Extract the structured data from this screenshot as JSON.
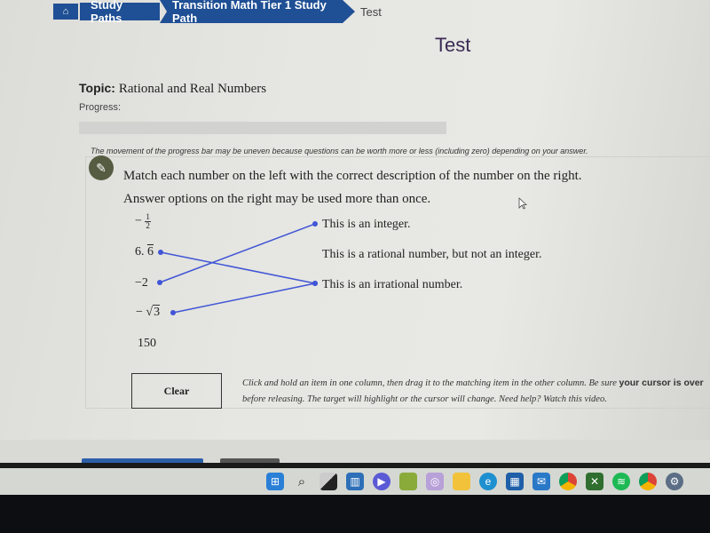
{
  "breadcrumb": {
    "home_icon": "home-icon",
    "items": [
      "Study Paths",
      "Transition Math Tier 1 Study Path"
    ],
    "current": "Test"
  },
  "page_title": "Test",
  "topic": {
    "label": "Topic:",
    "value": "Rational and Real Numbers"
  },
  "progress": {
    "label": "Progress:",
    "percent": 0,
    "note": "The movement of the progress bar may be uneven because questions can be worth more or less (including zero) depending on your answer."
  },
  "question": {
    "icon": "pencil-icon",
    "line1": "Match each number on the left with the correct description of the number on the right.",
    "line2": "Answer options on the right may be used more than once.",
    "left_items": [
      {
        "id": "neg-half",
        "label": "−1/2",
        "sign": "−",
        "numerator": "1",
        "denominator": "2"
      },
      {
        "id": "six-point-six-repeating",
        "label": "6.6̄",
        "whole": "6.",
        "repeating": "6"
      },
      {
        "id": "neg-two",
        "label": "−2"
      },
      {
        "id": "neg-sqrt-three",
        "label": "−√3",
        "sign": "−",
        "radicand": "3"
      },
      {
        "id": "one-fifty",
        "label": "150"
      }
    ],
    "right_items": [
      {
        "id": "integer",
        "label": "This is an integer."
      },
      {
        "id": "rational-not-integer",
        "label": "This is a rational number, but not an integer."
      },
      {
        "id": "irrational",
        "label": "This is an irrational number."
      }
    ],
    "matches": [
      {
        "from": "six-point-six-repeating",
        "to": "irrational"
      },
      {
        "from": "neg-two",
        "to": "integer"
      },
      {
        "from": "neg-sqrt-three",
        "to": "irrational"
      }
    ],
    "line_color": "#4055d6"
  },
  "clear_button": "Clear",
  "instructions": {
    "part1": "Click and hold an item in one column, then drag it to the matching item in the other column. Be sure ",
    "bold": "your cursor is over",
    "part2": "before releasing. The target will highlight or the cursor will change. Need help? Watch this video."
  },
  "taskbar": {
    "icons": [
      "windows-start-icon",
      "search-icon",
      "task-view-icon",
      "widgets-icon",
      "teams-chat-icon",
      "notes-app-icon",
      "photos-app-icon",
      "file-explorer-icon",
      "edge-browser-icon",
      "microsoft-store-icon",
      "mail-icon",
      "chrome-icon",
      "xbox-icon",
      "spotify-icon",
      "chrome-profile-icon",
      "settings-icon"
    ]
  }
}
